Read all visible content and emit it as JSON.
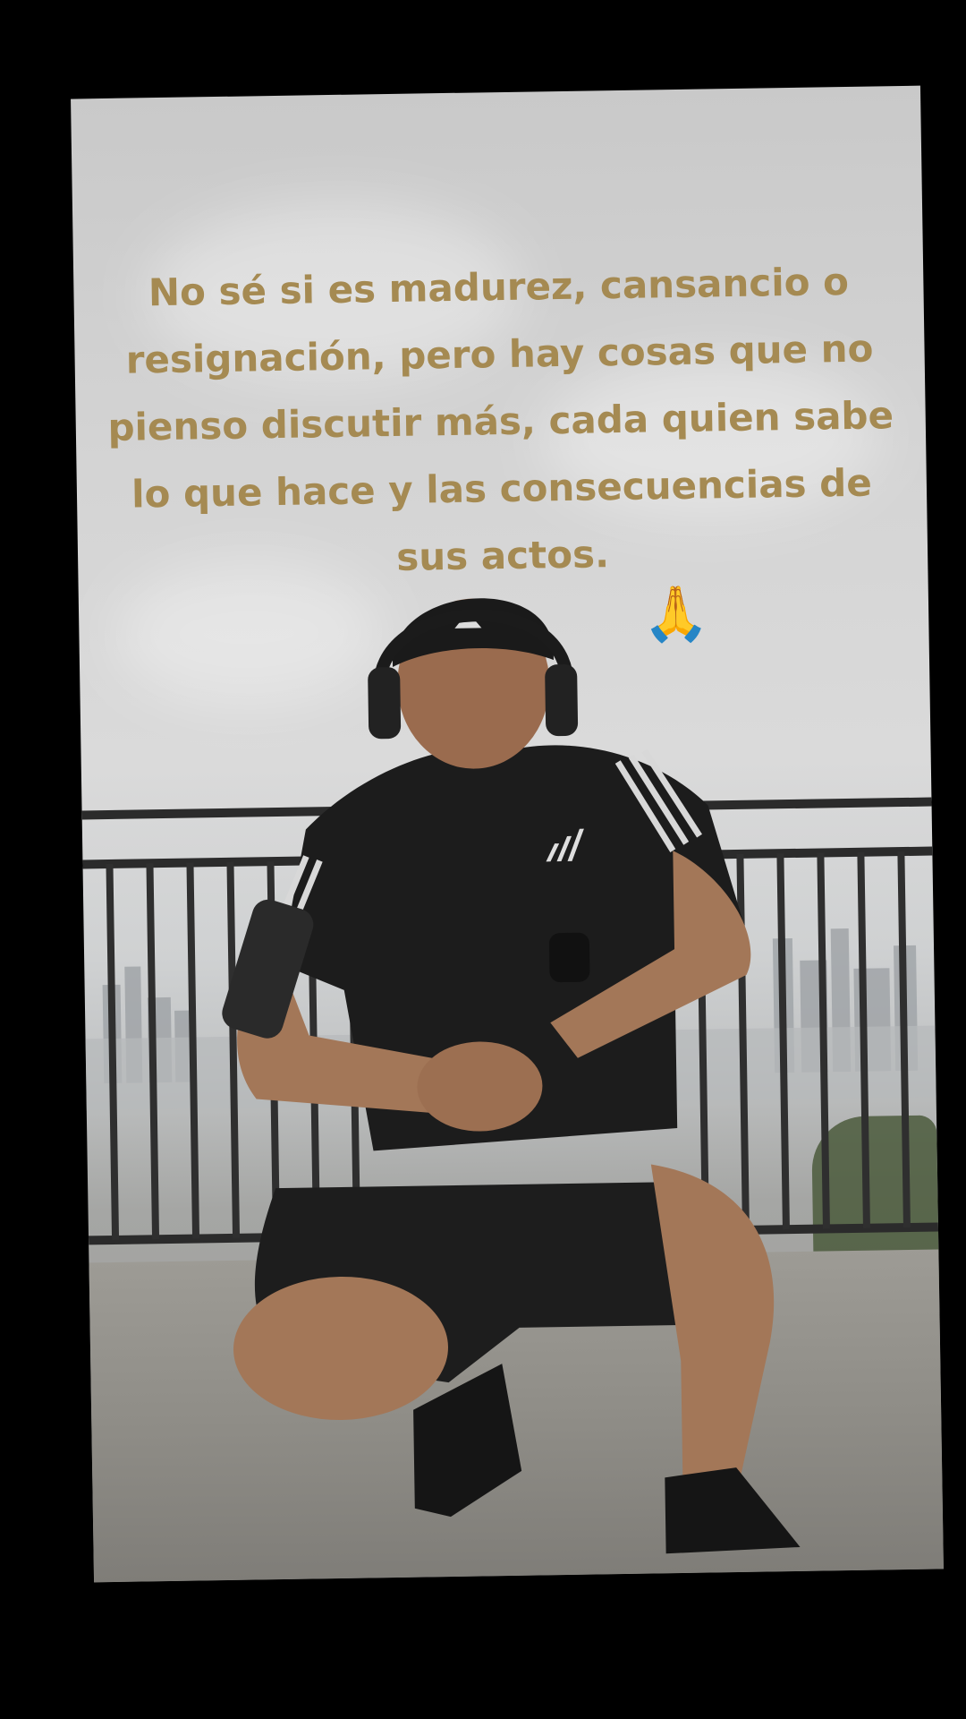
{
  "post": {
    "quote_lines": [
      "No sé si es madurez, cansancio o",
      "resignación, pero hay cosas que no",
      "pienso discutir más, cada quien sabe",
      "lo que hace y las consecuencias de",
      "sus actos."
    ],
    "emoji": "🙏"
  },
  "colors": {
    "background": "#000000",
    "quote_text": "#a58a52",
    "sky": "#d4d4d4",
    "shirt": "#1c1c1c"
  }
}
